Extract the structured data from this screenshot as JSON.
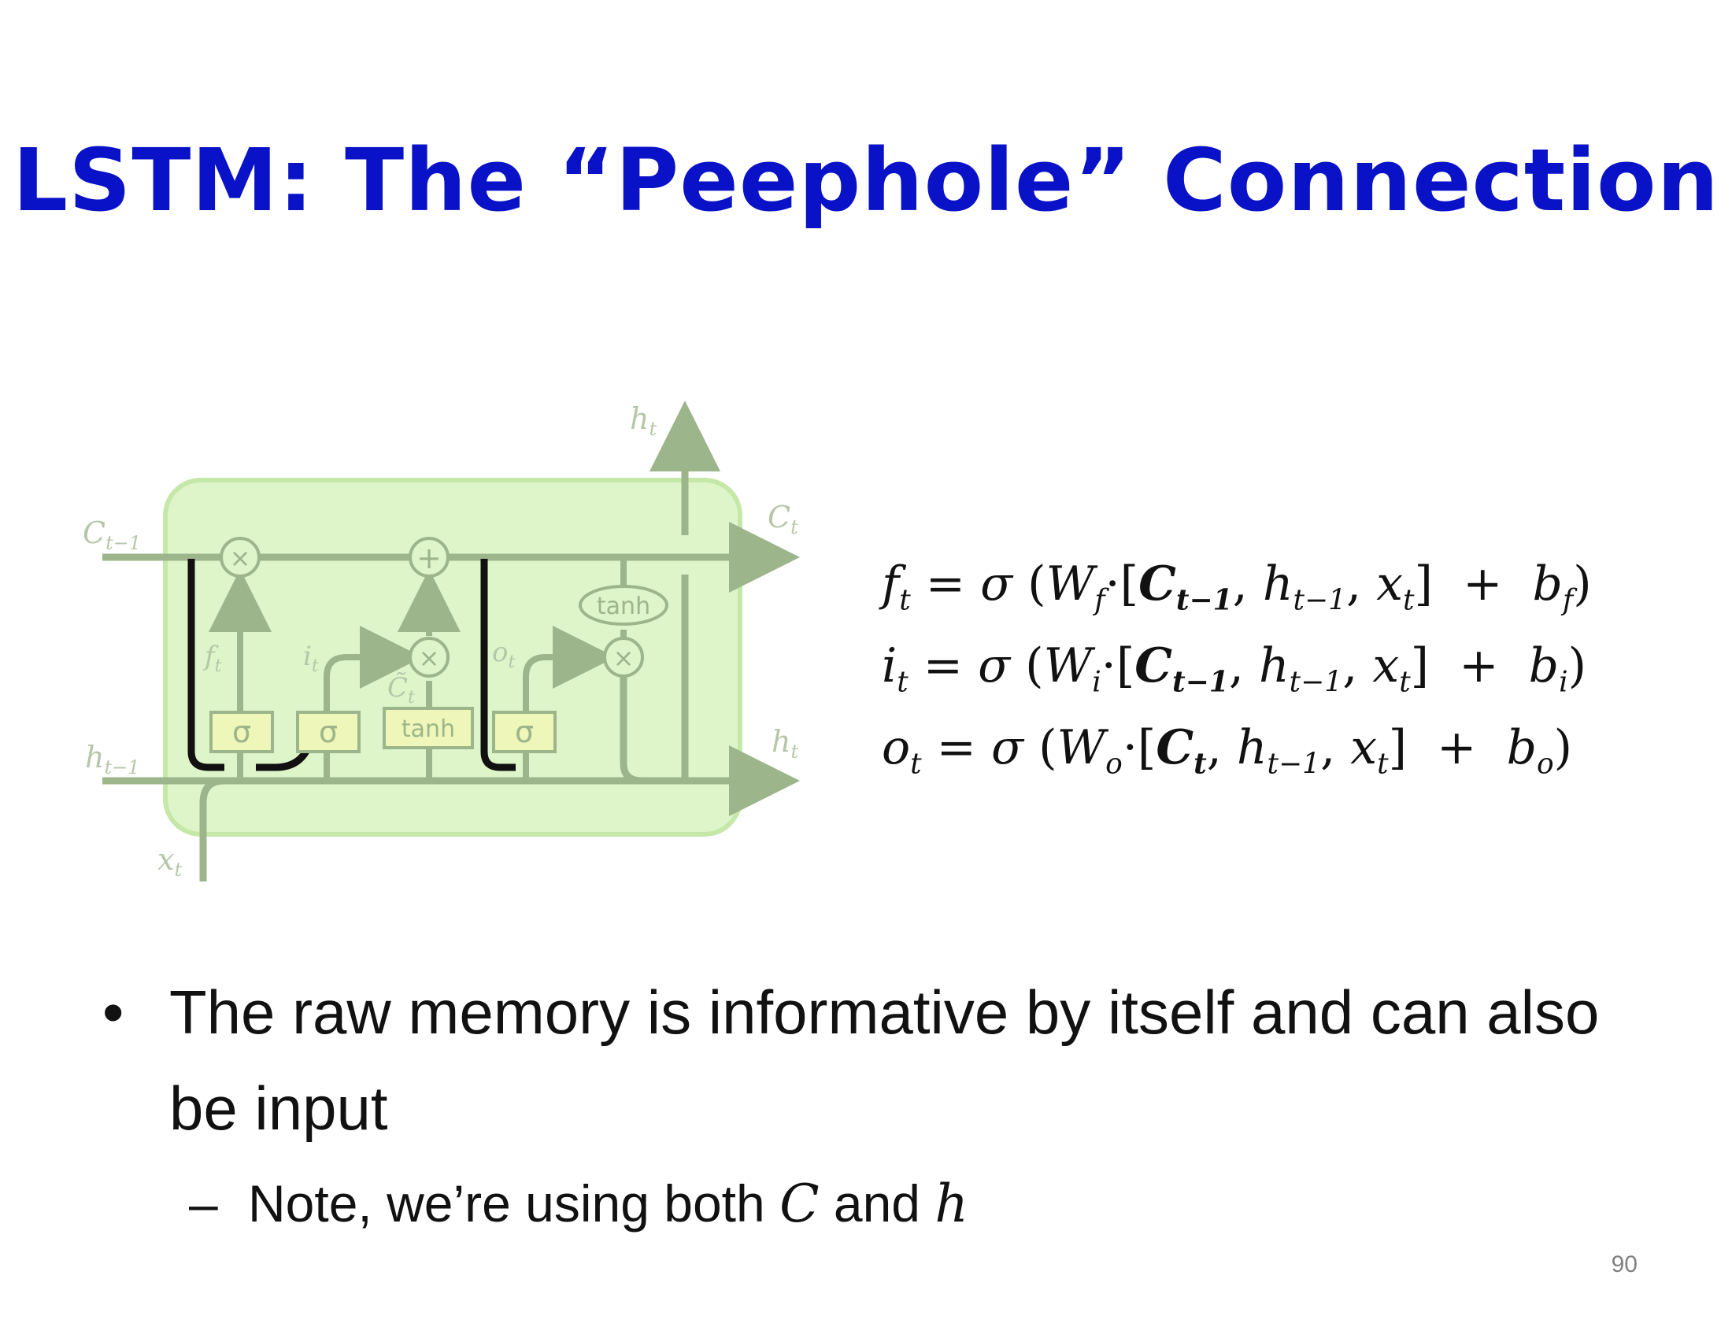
{
  "title": "LSTM: The “Peephole” Connection",
  "diagram": {
    "labels": {
      "c_prev": "C",
      "c_prev_sub": "t−1",
      "c_out": "C",
      "c_out_sub": "t",
      "h_prev": "h",
      "h_prev_sub": "t−1",
      "h_out_right": "h",
      "h_out_right_sub": "t",
      "h_out_top": "h",
      "h_out_top_sub": "t",
      "x_in": "x",
      "x_in_sub": "t",
      "f": "f",
      "f_sub": "t",
      "i": "i",
      "i_sub": "t",
      "o": "o",
      "o_sub": "t",
      "c_tilde": "C̃",
      "c_tilde_sub": "t"
    },
    "boxes": [
      "σ",
      "σ",
      "tanh",
      "σ"
    ],
    "ops": {
      "mult": "×",
      "add": "+"
    },
    "tanh_oval": "tanh",
    "colors": {
      "cell_fill": "#ddf5c8",
      "cell_stroke": "#c5e8a8",
      "lines": "#9db58a",
      "peephole": "#111111"
    }
  },
  "equations": [
    {
      "lhs": "f",
      "lhs_sub": "t",
      "w_sub": "f",
      "cell": "C",
      "cell_sub": "t−1",
      "b_sub": "f"
    },
    {
      "lhs": "i",
      "lhs_sub": "t",
      "w_sub": "i",
      "cell": "C",
      "cell_sub": "t−1",
      "b_sub": "i"
    },
    {
      "lhs": "o",
      "lhs_sub": "t",
      "w_sub": "o",
      "cell": "C",
      "cell_sub": "t",
      "b_sub": "o"
    }
  ],
  "eq_symbols": {
    "eq": "=",
    "sigma": "σ",
    "W": "W",
    "h": "h",
    "h_sub": "t−1",
    "x": "x",
    "x_sub": "t",
    "plus": "+",
    "b": "b"
  },
  "bullets": [
    {
      "marker": "•",
      "text": "The raw memory is informative by itself and can also be input"
    }
  ],
  "subbullet": {
    "marker": "–",
    "prefix": "Note, we’re using both ",
    "var1": "C",
    "mid": " and ",
    "var2": "h"
  },
  "page_number": "90"
}
